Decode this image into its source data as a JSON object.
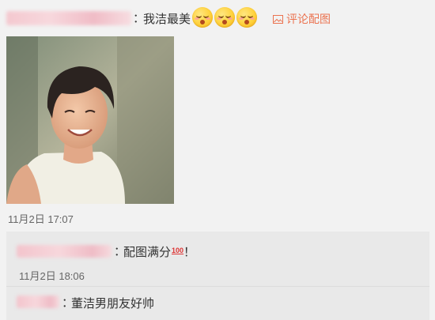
{
  "comment": {
    "colon": "：",
    "text": "我洁最美",
    "emojis": [
      "flushed-face-icon",
      "flushed-face-icon",
      "flushed-face-icon"
    ],
    "pic_link_label": "评论配图",
    "timestamp": "11月2日 17:07"
  },
  "replies": [
    {
      "colon": "：",
      "text": "配图满分",
      "badge": "100",
      "suffix": "！",
      "timestamp": "11月2日 18:06"
    },
    {
      "colon": "：",
      "text": "董洁男朋友好帅"
    }
  ],
  "colors": {
    "link": "#eb7350",
    "reply_bg": "#e9e9e9",
    "page_bg": "#f2f2f2"
  }
}
